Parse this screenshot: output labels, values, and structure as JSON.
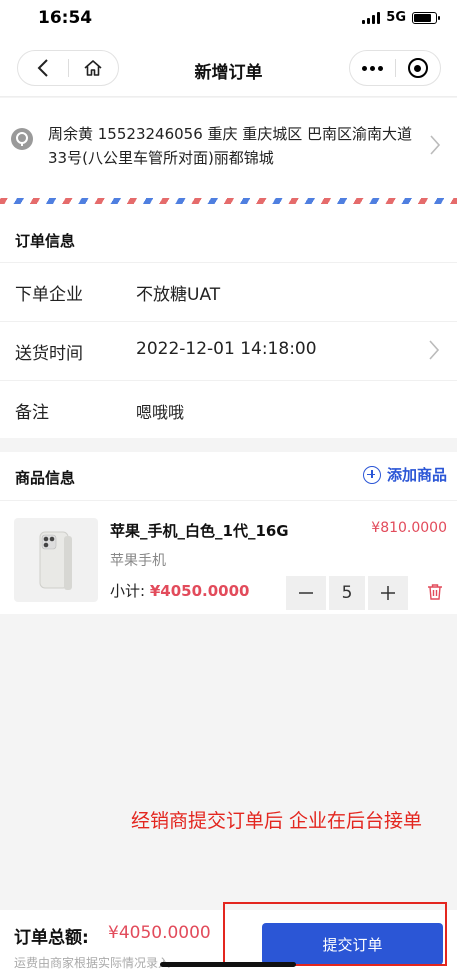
{
  "status_bar": {
    "time": "16:54",
    "network": "5G"
  },
  "nav": {
    "title": "新增订单",
    "back_icon": "chevron-left-icon",
    "home_icon": "home-icon",
    "more_icon": "more-dots-icon",
    "close_icon": "target-icon"
  },
  "address": {
    "text": "周余黄 15523246056 重庆 重庆城区 巴南区渝南大道33号(八公里车管所对面)丽都锦城"
  },
  "order_info": {
    "title": "订单信息",
    "rows": [
      {
        "label": "下单企业",
        "value": "不放糖UAT"
      },
      {
        "label": "送货时间",
        "value": "2022-12-01 14:18:00"
      },
      {
        "label": "备注",
        "value": "嗯哦哦"
      }
    ]
  },
  "goods": {
    "title": "商品信息",
    "add_label": "添加商品",
    "items": [
      {
        "name": "苹果_手机_白色_1代_16G",
        "price": "¥810.0000",
        "category": "苹果手机",
        "subtotal_label": "小计:",
        "subtotal": "¥4050.0000",
        "quantity": "5"
      }
    ]
  },
  "annotation": "经销商提交订单后 企业在后台接单",
  "footer": {
    "total_label": "订单总额:",
    "total_value": "¥4050.0000",
    "freight_note": "运费由商家根据实际情况录入",
    "submit_label": "提交订单"
  },
  "colors": {
    "accent": "#2b56d6",
    "price": "#e24b5b",
    "annotation": "#e3261f"
  }
}
